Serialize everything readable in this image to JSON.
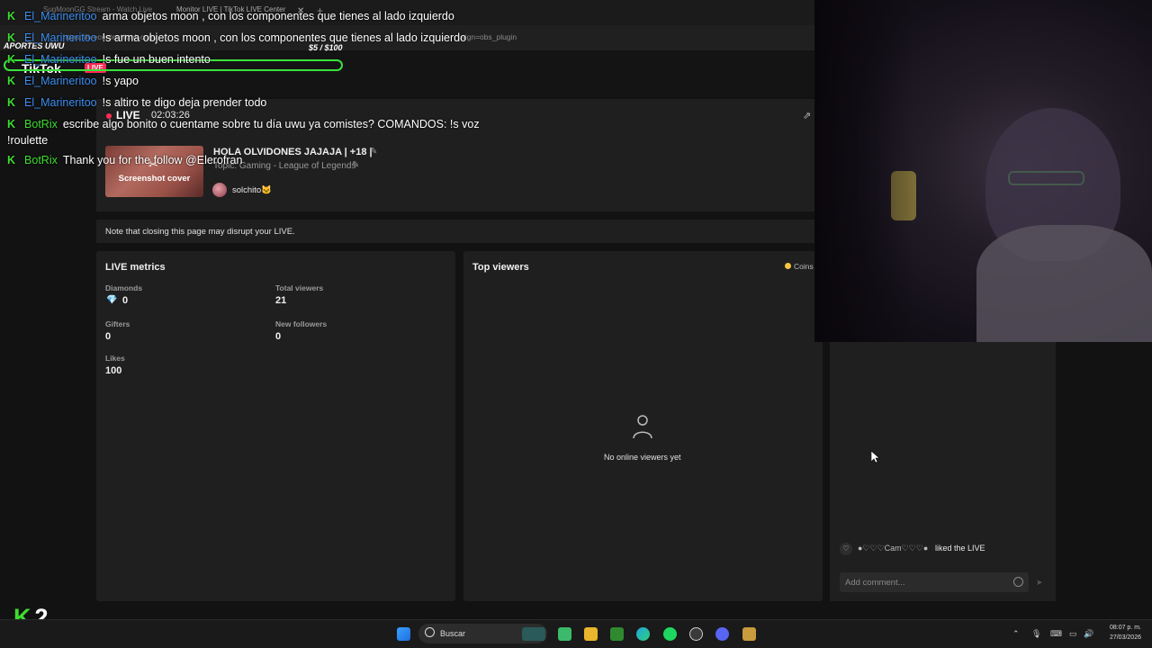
{
  "browser": {
    "tab1_title": "SugMoonGG Stream - Watch Live",
    "tab2_title": "Monitor LIVE | TikTok LIVE Center",
    "address_start": "https://livecenter.tiktok.com/...",
    "address_end": "aign=obs_plugin"
  },
  "tiktok_header": {
    "logo": "TikTok",
    "live_tag": "LIVE"
  },
  "overlay": {
    "aportes_label": "APORTES UWU",
    "goal_amount": "$5 / $100"
  },
  "stream_info": {
    "live_label": "LIVE",
    "timer": "02:03:26",
    "cover_label": "Screenshot cover",
    "title": "HOLA OLVIDONES JAJAJA | +18 |",
    "topic": "Topic: Gaming - League of Legends",
    "host": "solchito🐱"
  },
  "note": "Note that closing this page may disrupt your LIVE.",
  "metrics": {
    "title": "LIVE metrics",
    "diamonds_label": "Diamonds",
    "diamonds_value": "0",
    "total_viewers_label": "Total viewers",
    "total_viewers_value": "21",
    "gifters_label": "Gifters",
    "gifters_value": "0",
    "new_followers_label": "New followers",
    "new_followers_value": "0",
    "likes_label": "Likes",
    "likes_value": "100"
  },
  "top_viewers": {
    "title": "Top viewers",
    "coins_label": "Coins",
    "empty_text": "No online viewers yet"
  },
  "comments": {
    "liked_user": "●♡♡♡Cam♡♡♡●",
    "liked_text": "liked the LIVE",
    "placeholder": "Add comment..."
  },
  "chat": [
    {
      "user": "El_Marineritoo",
      "msg": "arma objetos moon , con los componentes que tienes al lado izquierdo",
      "bot": false
    },
    {
      "user": "El_Marineritoo",
      "msg": "!s arma objetos moon , con los componentes que tienes al lado izquierdo",
      "bot": false
    },
    {
      "user": "El_Marineritoo",
      "msg": "!s fue un buen intento",
      "bot": false
    },
    {
      "user": "El_Marineritoo",
      "msg": "!s yapo",
      "bot": false
    },
    {
      "user": "El_Marineritoo",
      "msg": "!s altiro te digo deja prender todo",
      "bot": false
    },
    {
      "user": "BotRix",
      "msg": "escribe algo bonito o cuentame sobre tu día uwu ya comistes? COMANDOS: !s voz",
      "bot": true
    },
    {
      "continuation": "!roulette"
    },
    {
      "user": "BotRix",
      "msg": "Thank you for the follow @Elerofran",
      "bot": true
    }
  ],
  "kick_counter": "2",
  "taskbar": {
    "search_label": "Buscar",
    "time": "08:07 p. m.",
    "date": "27/03/2026"
  },
  "colors": {
    "kick_green": "#3ddc2f",
    "tiktok_red": "#fe2c55",
    "chat_user_blue": "#3a8ef0"
  }
}
